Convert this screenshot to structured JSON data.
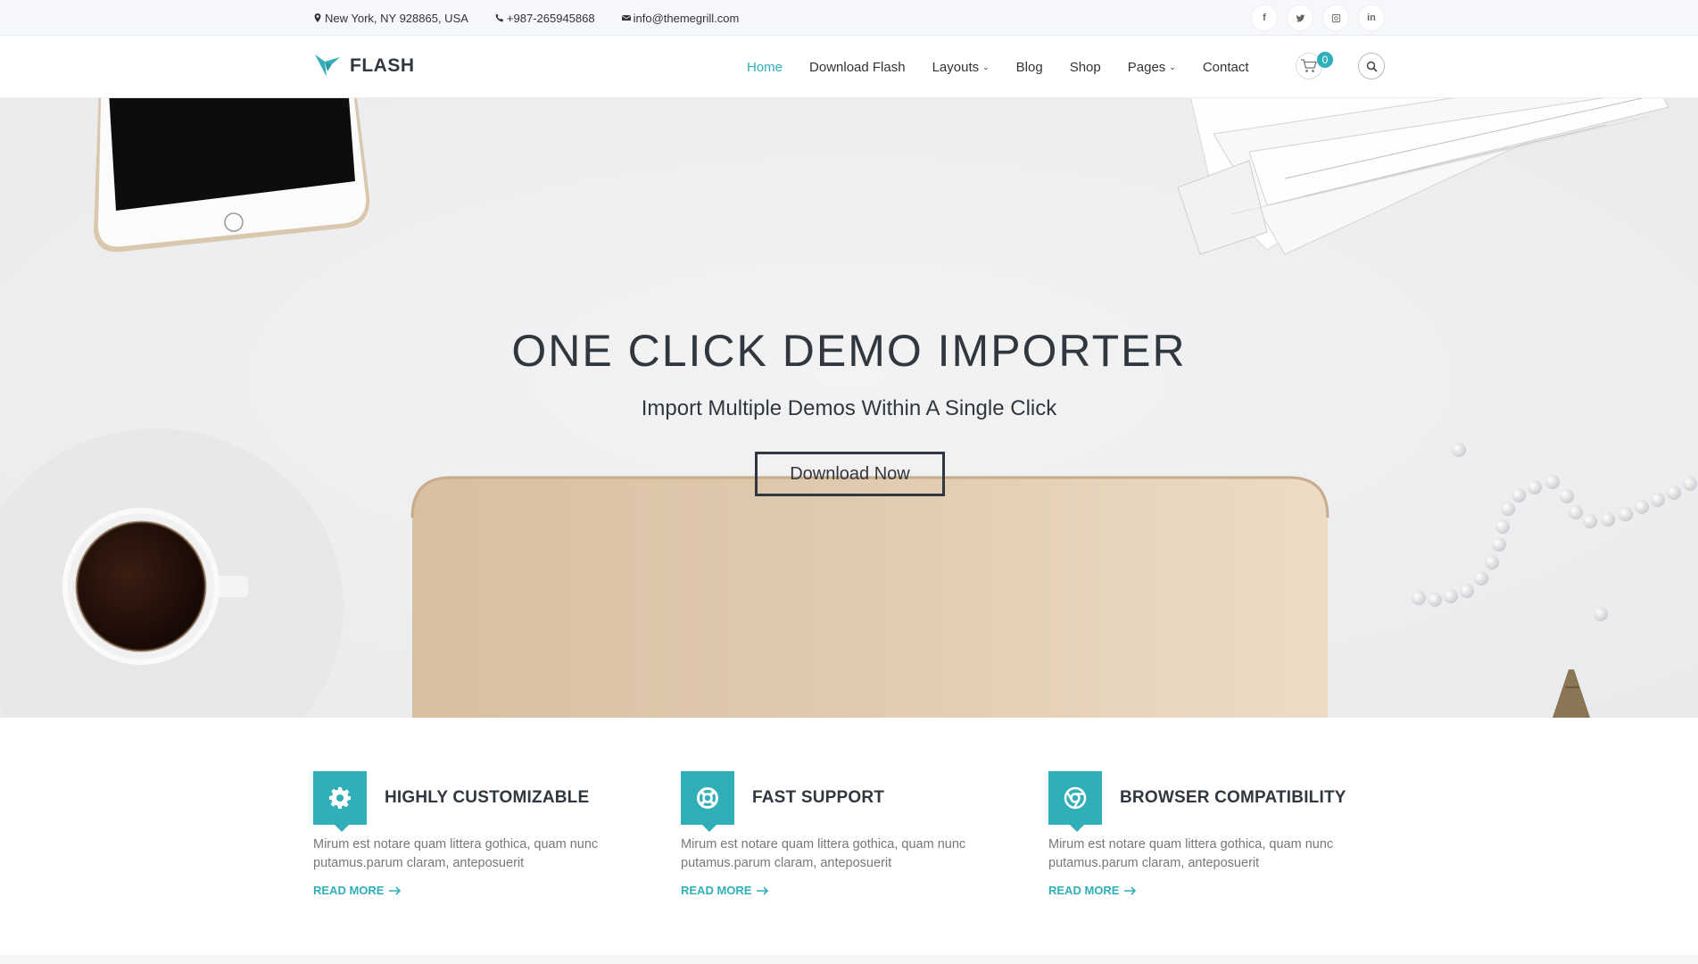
{
  "topbar": {
    "address": "New York, NY 928865, USA",
    "phone": "+987-265945868",
    "email": "info@themegrill.com",
    "social": [
      {
        "icon": "facebook-icon",
        "glyph": "f"
      },
      {
        "icon": "twitter-icon",
        "glyph": ""
      },
      {
        "icon": "instagram-icon",
        "glyph": ""
      },
      {
        "icon": "linkedin-icon",
        "glyph": "in"
      }
    ]
  },
  "header": {
    "logo_text": "FLASH",
    "nav": [
      {
        "label": "Home",
        "active": true,
        "dropdown": false
      },
      {
        "label": "Download Flash",
        "active": false,
        "dropdown": false
      },
      {
        "label": "Layouts",
        "active": false,
        "dropdown": true
      },
      {
        "label": "Blog",
        "active": false,
        "dropdown": false
      },
      {
        "label": "Shop",
        "active": false,
        "dropdown": false
      },
      {
        "label": "Pages",
        "active": false,
        "dropdown": true
      },
      {
        "label": "Contact",
        "active": false,
        "dropdown": false
      }
    ],
    "cart_count": "0"
  },
  "hero": {
    "title": "ONE CLICK DEMO IMPORTER",
    "subtitle": "Import Multiple Demos Within A Single Click",
    "button_label": "Download Now"
  },
  "features": [
    {
      "icon": "gear-icon",
      "title": "HIGHLY CUSTOMIZABLE",
      "text": "Mirum est notare quam littera gothica, quam nunc putamus.parum claram, anteposuerit",
      "link": "READ MORE"
    },
    {
      "icon": "life-ring-icon",
      "title": "FAST SUPPORT",
      "text": "Mirum est notare quam littera gothica, quam nunc putamus.parum claram, anteposuerit",
      "link": "READ MORE"
    },
    {
      "icon": "chrome-icon",
      "title": "BROWSER COMPATIBILITY",
      "text": "Mirum est notare quam littera gothica, quam nunc putamus.parum claram, anteposuerit",
      "link": "READ MORE"
    }
  ],
  "colors": {
    "accent": "#30afb8",
    "heading": "#30373e",
    "hero_bg": "#eff0f2"
  }
}
